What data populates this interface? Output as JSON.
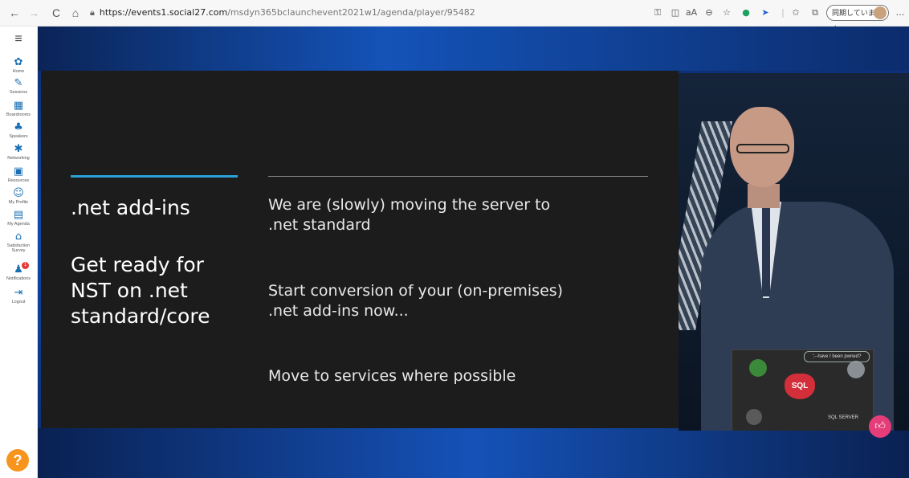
{
  "browser": {
    "url_host": "https://events1.social27.com",
    "url_path": "/msdyn365bclaunchevent2021w1/agenda/player/95482",
    "profile_label": "同期していません",
    "nav": {
      "back": "←",
      "forward": "→",
      "refresh": "C",
      "home": "⌂"
    },
    "more": "…"
  },
  "sidebar": {
    "menu_icon": "hamburger-icon",
    "items": [
      {
        "label": "Home",
        "icon": "home-icon",
        "glyph": "✿"
      },
      {
        "label": "Sessions",
        "icon": "pencil-icon",
        "glyph": "✎"
      },
      {
        "label": "Boardrooms",
        "icon": "boardroom-icon",
        "glyph": "▦"
      },
      {
        "label": "Speakers",
        "icon": "speaker-icon",
        "glyph": "♣"
      },
      {
        "label": "Networking",
        "icon": "networking-icon",
        "glyph": "✱"
      },
      {
        "label": "Resources",
        "icon": "resources-icon",
        "glyph": "▣"
      },
      {
        "label": "My Profile",
        "icon": "profile-icon",
        "glyph": "☺"
      },
      {
        "label": "My Agenda",
        "icon": "agenda-icon",
        "glyph": "▤"
      },
      {
        "label": "Satisfaction Survey",
        "icon": "survey-icon",
        "glyph": "⌂"
      },
      {
        "label": "Notifications",
        "icon": "bell-icon",
        "glyph": "♟",
        "badge": "1"
      },
      {
        "label": "Logout",
        "icon": "logout-icon",
        "glyph": "⇥"
      }
    ],
    "help": "?"
  },
  "slide": {
    "left_title": ".net add-ins",
    "left_subtitle_lines": [
      "Get ready for",
      "NST on .net",
      "standard/core"
    ],
    "points": [
      {
        "lines": [
          "We are (slowly) moving the server to",
          ".net standard"
        ]
      },
      {
        "lines": [
          "Start conversion of your (on-premises)",
          ".net add-ins now..."
        ]
      },
      {
        "lines": [
          "Move to services where possible"
        ]
      }
    ]
  },
  "video": {
    "sticker_sql": "SQL",
    "bubble_text": "';--have I been pwned?",
    "sqlserver_text": "SQL SERVER"
  },
  "like_icon": "thumbs-up-icon",
  "colors": {
    "accent_rule": "#2aa0d6",
    "stage_blue": "#1048a8",
    "like": "#e53d7a",
    "help": "#f7941d"
  }
}
